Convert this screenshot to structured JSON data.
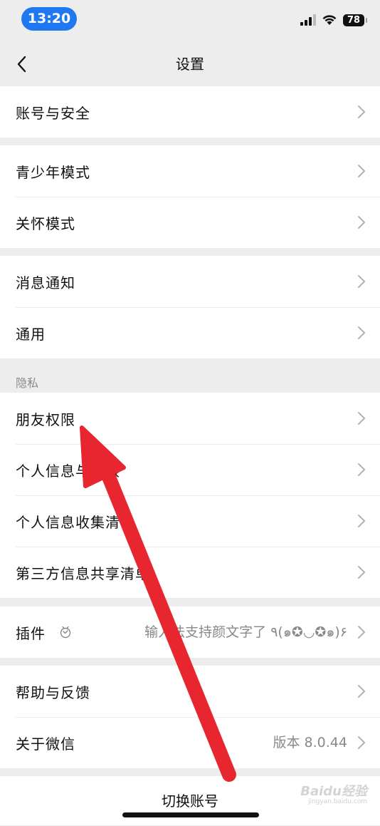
{
  "status": {
    "time": "13:20",
    "battery": "78"
  },
  "nav": {
    "title": "设置"
  },
  "groups": {
    "account": {
      "items": [
        {
          "label": "账号与安全"
        }
      ]
    },
    "modes": {
      "items": [
        {
          "label": "青少年模式"
        },
        {
          "label": "关怀模式"
        }
      ]
    },
    "general": {
      "items": [
        {
          "label": "消息通知"
        },
        {
          "label": "通用"
        }
      ]
    },
    "privacy": {
      "header": "隐私",
      "items": [
        {
          "label": "朋友权限"
        },
        {
          "label": "个人信息与权限"
        },
        {
          "label": "个人信息收集清单"
        },
        {
          "label": "第三方信息共享清单"
        }
      ]
    },
    "plugins": {
      "items": [
        {
          "label": "插件",
          "value": "输入法支持颜文字了 ٩(๑✪◡✪๑)۶"
        }
      ]
    },
    "help": {
      "items": [
        {
          "label": "帮助与反馈"
        },
        {
          "label": "关于微信",
          "value": "版本 8.0.44"
        }
      ]
    }
  },
  "bottom": {
    "switch_account": "切换账号"
  },
  "watermark": {
    "main": "Baidu经验",
    "sub": "jingyan.baidu.com"
  },
  "colors": {
    "status_pill": "#1f78f0",
    "background": "#ededed",
    "annotation_arrow": "#e8262f"
  }
}
